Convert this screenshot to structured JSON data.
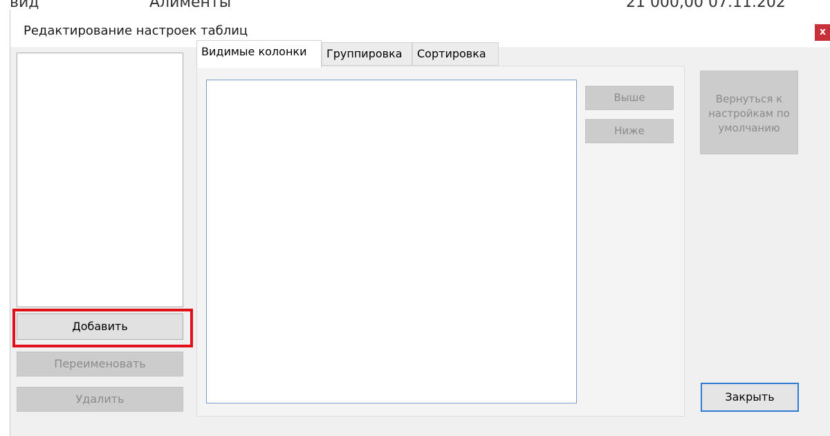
{
  "background_window": {
    "col1": "вид",
    "col2": "Алименты",
    "col3": "21 000,00    07.11.202"
  },
  "dialog": {
    "title": "Редактирование настроек таблиц",
    "close_glyph": "x"
  },
  "profiles": {
    "add_label": "Добавить",
    "rename_label": "Переименовать",
    "delete_label": "Удалить"
  },
  "tabs": [
    {
      "label": "Видимые колонки",
      "active": true
    },
    {
      "label": "Группировка",
      "active": false
    },
    {
      "label": "Сортировка",
      "active": false
    }
  ],
  "columns_panel": {
    "up_label": "Выше",
    "down_label": "Ниже"
  },
  "right_panel": {
    "reset_label": "Вернуться к\nнастройкам по\nумолчанию",
    "close_label": "Закрыть"
  },
  "colors": {
    "highlight": "#e0101a",
    "close_button": "#c8303a",
    "focus_border": "#2a7ad6"
  }
}
